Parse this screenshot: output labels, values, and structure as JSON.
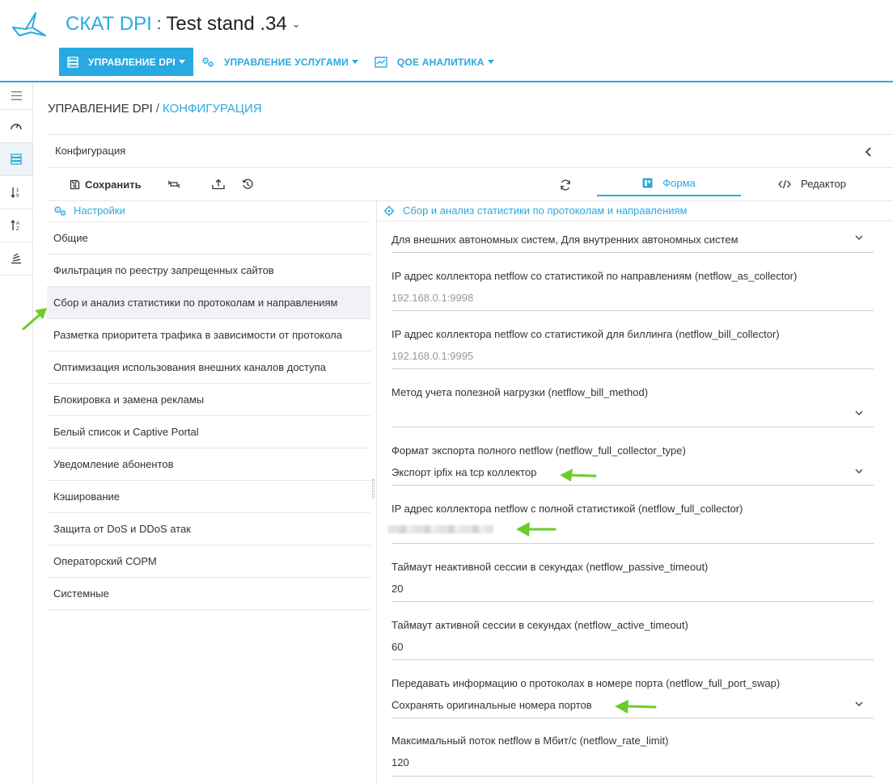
{
  "app": {
    "name": "СКАТ DPI",
    "colon": ":",
    "stand": "Test stand .34",
    "stand_caret": "⌄"
  },
  "topnav": [
    {
      "label": "УПРАВЛЕНИЕ DPI",
      "icon": "server-icon",
      "active": true
    },
    {
      "label": "УПРАВЛЕНИЕ УСЛУГАМИ",
      "icon": "gears-icon",
      "active": false
    },
    {
      "label": "QOE АНАЛИТИКА",
      "icon": "chart-icon",
      "active": false
    }
  ],
  "breadcrumb": {
    "parent": "УПРАВЛЕНИЕ DPI",
    "sep": "/",
    "current": "КОНФИГУРАЦИЯ"
  },
  "config": {
    "title": "Конфигурация",
    "save_label": "Сохранить",
    "tab_form": "Форма",
    "tab_editor": "Редактор"
  },
  "settings": {
    "header": "Настройки",
    "items": [
      "Общие",
      "Фильтрация по реестру запрещенных сайтов",
      "Сбор и анализ статистики по протоколам и направлениям",
      "Разметка приоритета трафика в зависимости от протокола",
      "Оптимизация использования внешних каналов доступа",
      "Блокировка и замена рекламы",
      "Белый список и Captive Portal",
      "Уведомление абонентов",
      "Кэширование",
      "Защита от DoS и DDoS атак",
      "Операторский СОРМ",
      "Системные"
    ],
    "active_index": 2
  },
  "form": {
    "header": "Сбор и анализ статистики по протоколам и направлениям",
    "fields": {
      "as_type": {
        "value": "Для внешних автономных систем, Для внутренних автономных систем"
      },
      "as_collector": {
        "label": "IP адрес коллектора netflow со статистикой по направлениям (netflow_as_collector)",
        "value": "192.168.0.1:9998"
      },
      "bill_collector": {
        "label": "IP адрес коллектора netflow со статистикой для биллинга (netflow_bill_collector)",
        "value": "192.168.0.1:9995"
      },
      "bill_method": {
        "label": "Метод учета полезной нагрузки (netflow_bill_method)",
        "value": ""
      },
      "full_collector_type": {
        "label": "Формат экспорта полного netflow (netflow_full_collector_type)",
        "value": "Экспорт ipfix на tcp коллектор"
      },
      "full_collector": {
        "label": "IP адрес коллектора netflow с полной статистикой (netflow_full_collector)",
        "value": ""
      },
      "passive_timeout": {
        "label": "Таймаут неактивной сессии в секундах (netflow_passive_timeout)",
        "value": "20"
      },
      "active_timeout": {
        "label": "Таймаут активной сессии в секундах (netflow_active_timeout)",
        "value": "60"
      },
      "full_port_swap": {
        "label": "Передавать информацию о протоколах в номере порта (netflow_full_port_swap)",
        "value": "Сохранять оригинальные номера портов"
      },
      "rate_limit": {
        "label": "Максимальный поток netflow в Мбит/с (netflow_rate_limit)",
        "value": "120"
      }
    }
  },
  "colors": {
    "accent": "#29a9e1",
    "annotation_arrow": "#6ccc2a"
  }
}
